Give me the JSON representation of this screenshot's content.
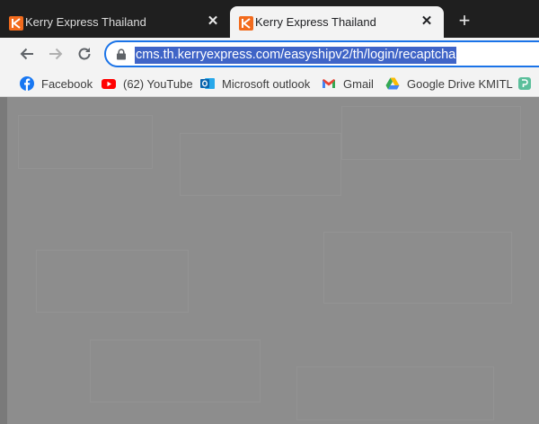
{
  "tabs": [
    {
      "title": "Kerry Express Thailand",
      "active": false
    },
    {
      "title": "Kerry Express Thailand",
      "active": true
    }
  ],
  "address_bar": {
    "url": "cms.th.kerryexpress.com/easyshipv2/th/login/recaptcha"
  },
  "bookmarks": [
    {
      "label": "Facebook",
      "icon": "facebook-icon"
    },
    {
      "label": "(62) YouTube",
      "icon": "youtube-icon"
    },
    {
      "label": "Microsoft outlook",
      "icon": "outlook-icon"
    },
    {
      "label": "Gmail",
      "icon": "gmail-icon"
    },
    {
      "label": "Google Drive KMITL",
      "icon": "google-drive-icon"
    }
  ],
  "colors": {
    "accent": "#1a73e8",
    "brand": "#f26b1d",
    "url_highlight": "#3f64c7"
  }
}
